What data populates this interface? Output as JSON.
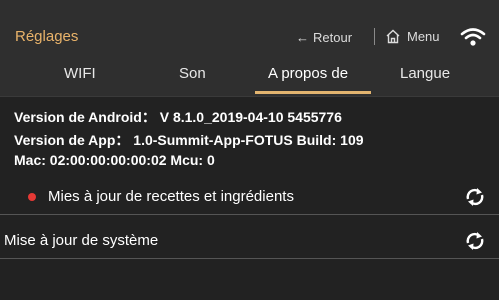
{
  "header": {
    "title": "Réglages",
    "back_label": "Retour",
    "menu_label": "Menu"
  },
  "tabs": [
    {
      "label": "WIFI"
    },
    {
      "label": "Son"
    },
    {
      "label": "A propos de",
      "active": true
    },
    {
      "label": "Langue"
    }
  ],
  "info": {
    "android_version": "Version de Android： V 8.1.0_2019-04-10  5455776",
    "app_version": "Version de App：  1.0-Summit-App-FOTUS Build: 109",
    "mac": "Mac: 02:00:00:00:00:02  Mcu: 0"
  },
  "updates": [
    {
      "label": "Mies à jour de recettes et ingrédients",
      "has_dot": true
    },
    {
      "label": "Mise à jour de système",
      "has_dot": false
    }
  ],
  "colors": {
    "accent": "#e2b46f",
    "background": "#222222",
    "header": "#2f2f2f",
    "notification_dot": "#e53935"
  },
  "icons": [
    "arrow-left-icon",
    "home-icon",
    "wifi-icon",
    "sync-icon"
  ]
}
